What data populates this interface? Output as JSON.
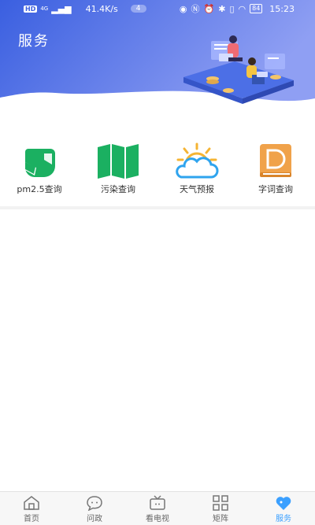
{
  "status_bar": {
    "hd": "HD",
    "signal": "4G",
    "speed": "41.4K/s",
    "notifications": "4",
    "battery": "84",
    "time": "15:23"
  },
  "page": {
    "title": "服务"
  },
  "services": [
    {
      "label": "pm2.5查询",
      "icon": "mask-icon",
      "color": "#1bb061"
    },
    {
      "label": "污染查询",
      "icon": "map-icon",
      "color": "#1bb061"
    },
    {
      "label": "天气预报",
      "icon": "weather-icon",
      "color": "#2fa4ee"
    },
    {
      "label": "字词查询",
      "icon": "dictionary-icon",
      "color": "#f0a24a"
    }
  ],
  "nav": {
    "items": [
      {
        "label": "首页",
        "icon": "home-icon"
      },
      {
        "label": "问政",
        "icon": "chat-icon"
      },
      {
        "label": "看电视",
        "icon": "tv-icon"
      },
      {
        "label": "矩阵",
        "icon": "grid-icon"
      },
      {
        "label": "服务",
        "icon": "heart-icon"
      }
    ],
    "active": "服务",
    "active_color": "#3ba0ff"
  },
  "header": {
    "gradient_start": "#3a62e0",
    "gradient_end": "#8a9cf2"
  }
}
